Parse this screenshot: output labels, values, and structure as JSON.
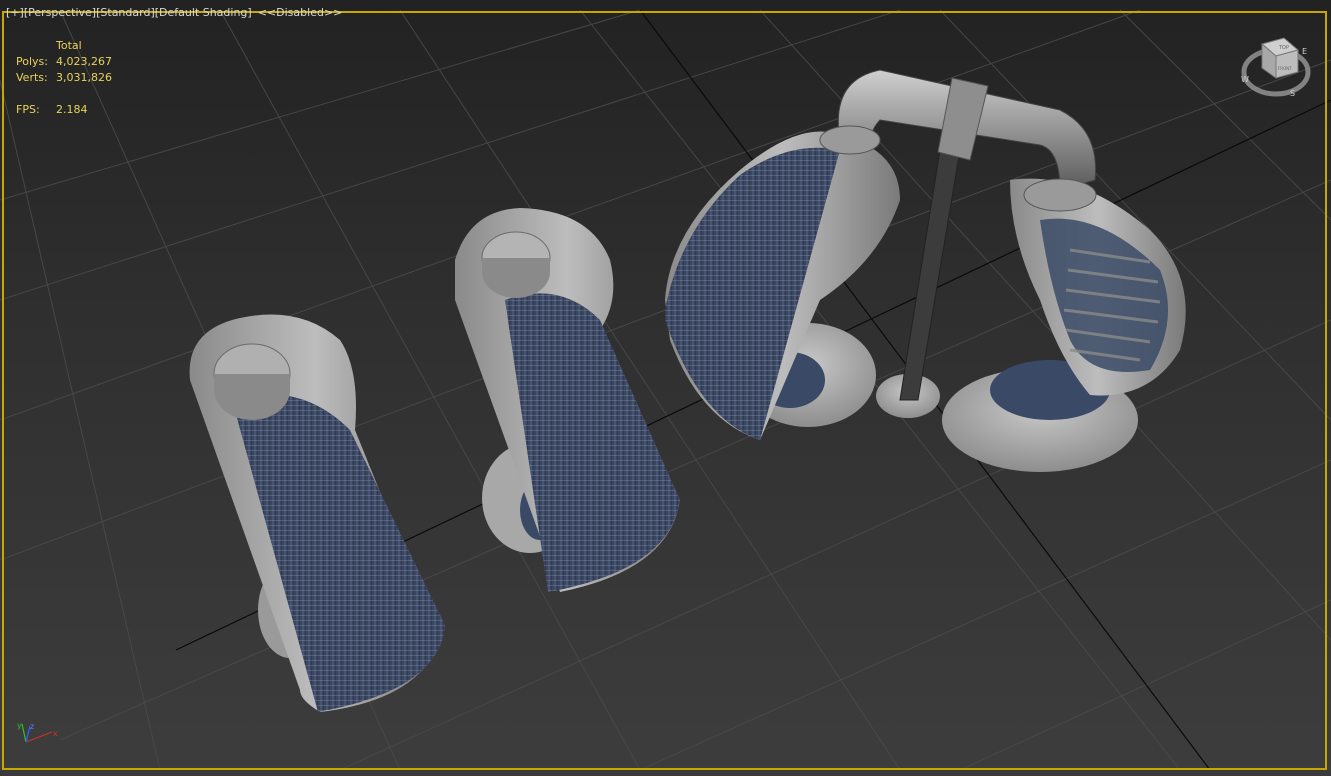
{
  "viewport": {
    "labels": {
      "plus": "[+]",
      "view": "[Perspective]",
      "preset": "[Standard]",
      "shading": "[Default Shading]",
      "disabled": "<<Disabled>>"
    },
    "stats": {
      "total_label": "Total",
      "polys_label": "Polys:",
      "polys_value": "4,023,267",
      "verts_label": "Verts:",
      "verts_value": "3,031,826",
      "fps_label": "FPS:",
      "fps_value": "2.184"
    },
    "viewcube": {
      "top_label": "TOP",
      "front_label": "FRONT",
      "compass": [
        "W",
        "S",
        "E"
      ]
    },
    "axis": {
      "x": "x",
      "y": "y",
      "z": "z"
    },
    "colors": {
      "active_border": "#c8a800",
      "stats_text": "#e8d25a",
      "label_text": "#d8d8d8",
      "model_gray": "#a8a8a8",
      "wire_blue": "#3a4a66"
    }
  }
}
